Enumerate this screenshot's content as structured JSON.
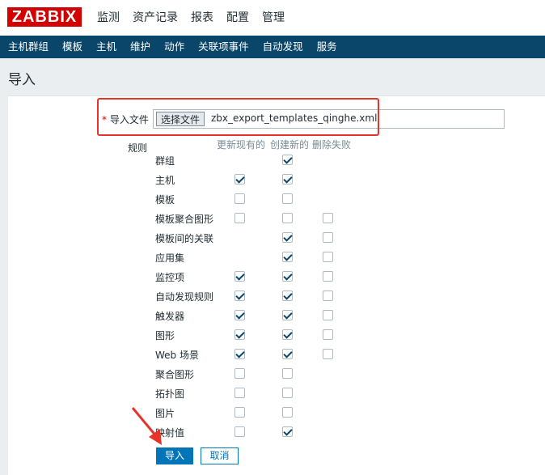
{
  "logo": "ZABBIX",
  "main_menu": [
    "监测",
    "资产记录",
    "报表",
    "配置",
    "管理"
  ],
  "sub_menu": [
    "主机群组",
    "模板",
    "主机",
    "维护",
    "动作",
    "关联项事件",
    "自动发现",
    "服务"
  ],
  "page_title": "导入",
  "form": {
    "file_label": "导入文件",
    "file_button": "选择文件",
    "file_name": "zbx_export_templates_qinghe.xml",
    "rules_label": "规则",
    "col_update": "更新现有的",
    "col_create": "创建新的",
    "col_delete": "删除失败"
  },
  "rules": [
    {
      "name": "群组",
      "update": null,
      "create": true,
      "delete": null
    },
    {
      "name": "主机",
      "update": true,
      "create": true,
      "delete": null
    },
    {
      "name": "模板",
      "update": false,
      "create": false,
      "delete": null
    },
    {
      "name": "模板聚合图形",
      "update": false,
      "create": false,
      "delete": false
    },
    {
      "name": "模板间的关联",
      "update": null,
      "create": true,
      "delete": false
    },
    {
      "name": "应用集",
      "update": null,
      "create": true,
      "delete": false
    },
    {
      "name": "监控项",
      "update": true,
      "create": true,
      "delete": false
    },
    {
      "name": "自动发现规则",
      "update": true,
      "create": true,
      "delete": false
    },
    {
      "name": "触发器",
      "update": true,
      "create": true,
      "delete": false
    },
    {
      "name": "图形",
      "update": true,
      "create": true,
      "delete": false
    },
    {
      "name": "Web 场景",
      "update": true,
      "create": true,
      "delete": false
    },
    {
      "name": "聚合图形",
      "update": false,
      "create": false,
      "delete": null
    },
    {
      "name": "拓扑图",
      "update": false,
      "create": false,
      "delete": null
    },
    {
      "name": "图片",
      "update": false,
      "create": false,
      "delete": null
    },
    {
      "name": "映射值",
      "update": false,
      "create": true,
      "delete": null
    }
  ],
  "buttons": {
    "import": "导入",
    "cancel": "取消"
  },
  "colors": {
    "brand": "#d40000",
    "nav": "#0a466a",
    "primary": "#0275b8",
    "annotation": "#e8332a"
  }
}
